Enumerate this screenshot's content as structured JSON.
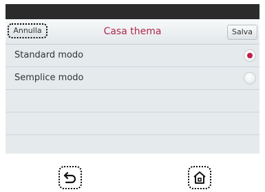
{
  "header": {
    "cancel_label": "Annulla",
    "title": "Casa thema",
    "save_label": "Salva"
  },
  "options": [
    {
      "label": "Standard modo",
      "selected": true
    },
    {
      "label": "Semplice modo",
      "selected": false
    }
  ],
  "nav": {
    "back_icon": "back-icon",
    "home_icon": "home-icon"
  },
  "colors": {
    "accent": "#c0204a",
    "title": "#b0284e",
    "background": "#e5ebed"
  }
}
